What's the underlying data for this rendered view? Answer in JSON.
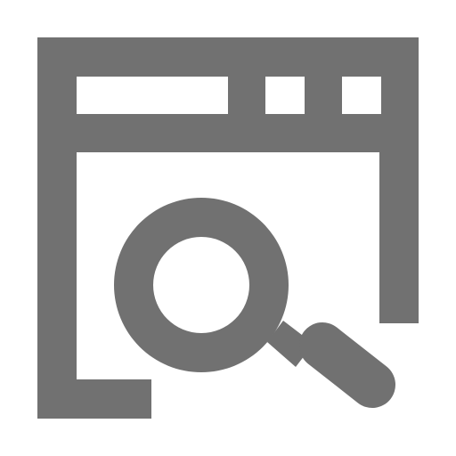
{
  "icon": {
    "name": "browser-window-search-icon",
    "color": "#717171",
    "background": "#ffffff"
  }
}
